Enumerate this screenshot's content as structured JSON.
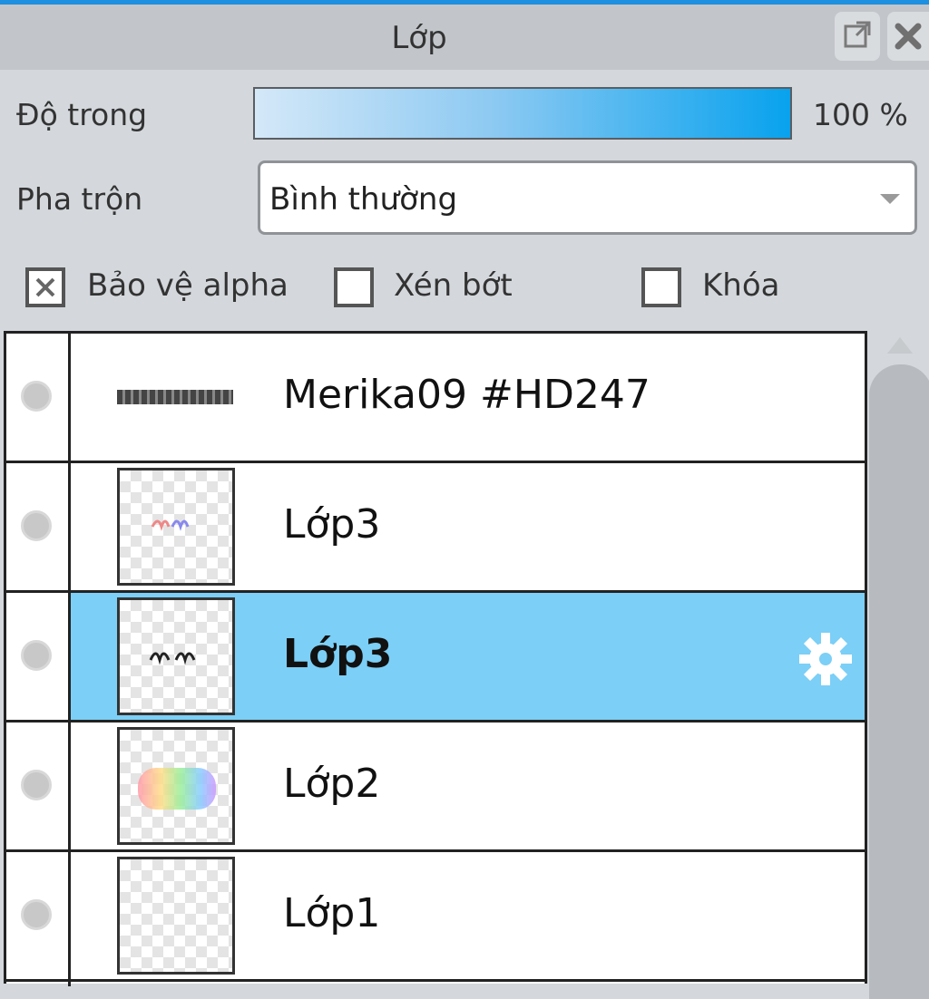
{
  "panel": {
    "title": "Lớp"
  },
  "opacity": {
    "label": "Độ trong",
    "value_text": "100 %",
    "value": 100
  },
  "blend": {
    "label": "Pha trộn",
    "selected": "Bình thường"
  },
  "options": [
    {
      "label": "Bảo vệ alpha",
      "checked": true
    },
    {
      "label": "Xén bớt",
      "checked": false
    },
    {
      "label": "Khóa",
      "checked": false
    }
  ],
  "layers": [
    {
      "name": "Merika09 #HD247",
      "type": "text",
      "selected": false
    },
    {
      "name": "Lớp3",
      "type": "raster",
      "selected": false
    },
    {
      "name": "Lớp3",
      "type": "raster",
      "selected": true
    },
    {
      "name": "Lớp2",
      "type": "raster",
      "selected": false
    },
    {
      "name": "Lớp1",
      "type": "raster",
      "selected": false
    }
  ],
  "colors": {
    "selection": "#7ccff6",
    "accent": "#1e90e0"
  },
  "icons": {
    "popout": "popout-icon",
    "close": "close-icon",
    "settings": "gear-icon"
  }
}
